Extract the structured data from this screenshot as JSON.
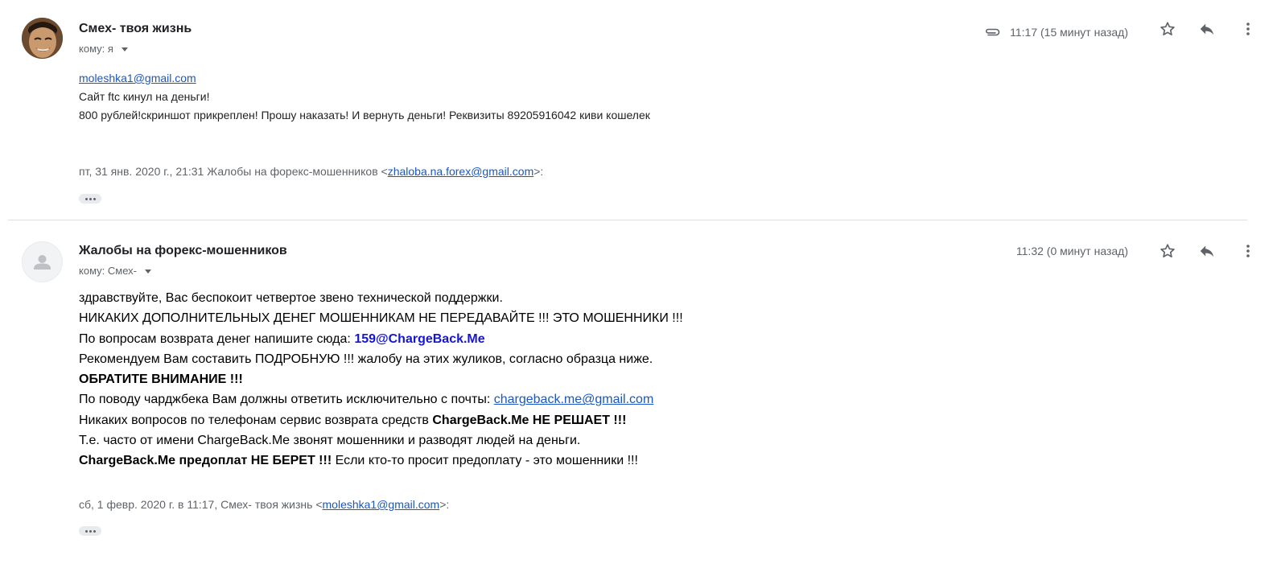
{
  "messages": [
    {
      "sender": "Смех- твоя жизнь",
      "recipient": "кому: я",
      "time": "11:17 (15 минут назад)",
      "has_attachment": true,
      "body": {
        "email": "moleshka1@gmail.com",
        "line1": "Сайт ftc кинул на деньги!",
        "line2": "800 рублей!скриншот прикреплен! Прошу наказать! И вернуть деньги! Реквизиты 89205916042 киви кошелек"
      },
      "quote": {
        "prefix": "пт, 31 янв. 2020 г., 21:31 Жалобы на форекс-мошенников <",
        "email": "zhaloba.na.forex@gmail.com",
        "suffix": ">:"
      }
    },
    {
      "sender": "Жалобы на форекс-мошенников",
      "recipient": "кому: Смех-",
      "time": "11:32 (0 минут назад)",
      "body": {
        "l1": "здравствуйте, Вас беспокоит четвертое звено технической поддержки.",
        "l2": "НИКАКИХ ДОПОЛНИТЕЛЬНЫХ ДЕНЕГ МОШЕННИКАМ НЕ ПЕРЕДАВАЙТЕ !!! ЭТО МОШЕННИКИ !!!",
        "l3_text": "По вопросам возврата денег напишите сюда: ",
        "l3_email": "159@ChargeBack.Me",
        "l4": "Рекомендуем Вам составить ПОДРОБНУЮ !!! жалобу на этих жуликов, согласно образца ниже.",
        "l5": "ОБРАТИТЕ ВНИМАНИЕ !!!",
        "l6_text": "По поводу чарджбека Вам должны ответить исключительно с почты: ",
        "l6_email": "chargeback.me@gmail.com",
        "l7_text": "Никаких вопросов по телефонам сервис возврата средств ",
        "l7_bold": "ChargeBack.Me НЕ РЕШАЕТ !!!",
        "l8": "Т.е. часто от имени ChargeBack.Me звонят мошенники и разводят людей на деньги.",
        "l9_bold": "ChargeBack.Me предоплат НЕ БЕРЕТ !!!",
        "l9_text": " Если кто-то просит предоплату - это мошенники !!!"
      },
      "quote": {
        "prefix": "сб, 1 февр. 2020 г. в 11:17, Смех- твоя жизнь <",
        "email": "moleshka1@gmail.com",
        "suffix": ">:"
      }
    }
  ],
  "icons": {
    "attachment": "paperclip-icon",
    "star": "star-icon",
    "reply": "reply-icon",
    "more": "more-vert-icon",
    "show_trimmed": "ellipsis-icon"
  },
  "colors": {
    "link": "#1a57c4",
    "highlight_email": "#1515d6",
    "secondary_text": "#5f6368"
  }
}
